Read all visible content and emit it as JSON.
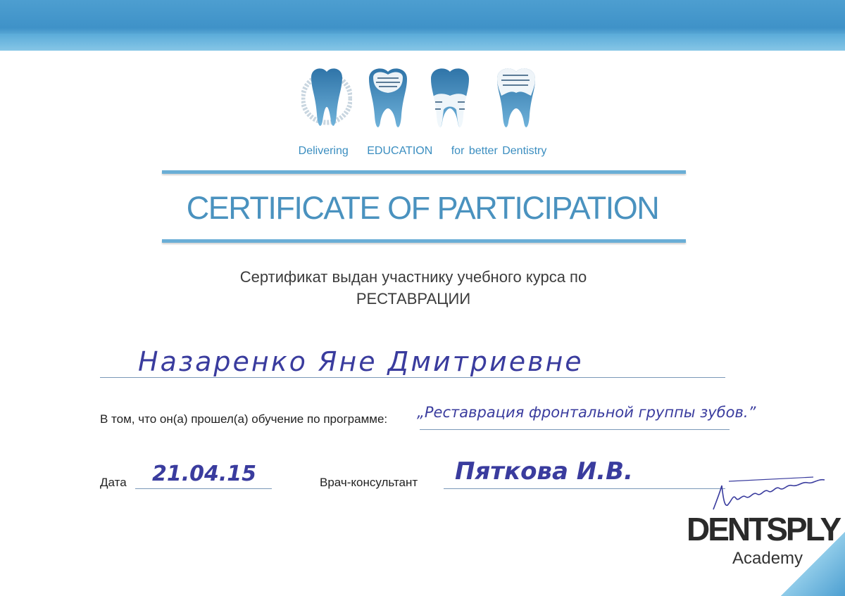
{
  "header": {
    "slogan": [
      "Delivering",
      "EDUCATION",
      "for better Dentistry"
    ],
    "band_color": "#4d9ed0",
    "accent_color": "#4a92bf"
  },
  "certificate": {
    "title": "CERTIFICATE OF PARTICIPATION",
    "subtitle_line1": "Сертификат выдан участнику учебного курса по",
    "subtitle_line2": "РЕСТАВРАЦИИ",
    "recipient_name": "Назаренко Яне Дмитриевне",
    "program_label": "В том, что он(а) прошел(а) обучение по программе:",
    "program_value": "„Реставрация фронтальной группы зубов.”",
    "date_label": "Дата",
    "date_value": "21.04.15",
    "consultant_label": "Врач-консультант",
    "consultant_value": "Пяткова И.В."
  },
  "brand": {
    "name": "DENTSPLY",
    "sub": "Academy"
  }
}
